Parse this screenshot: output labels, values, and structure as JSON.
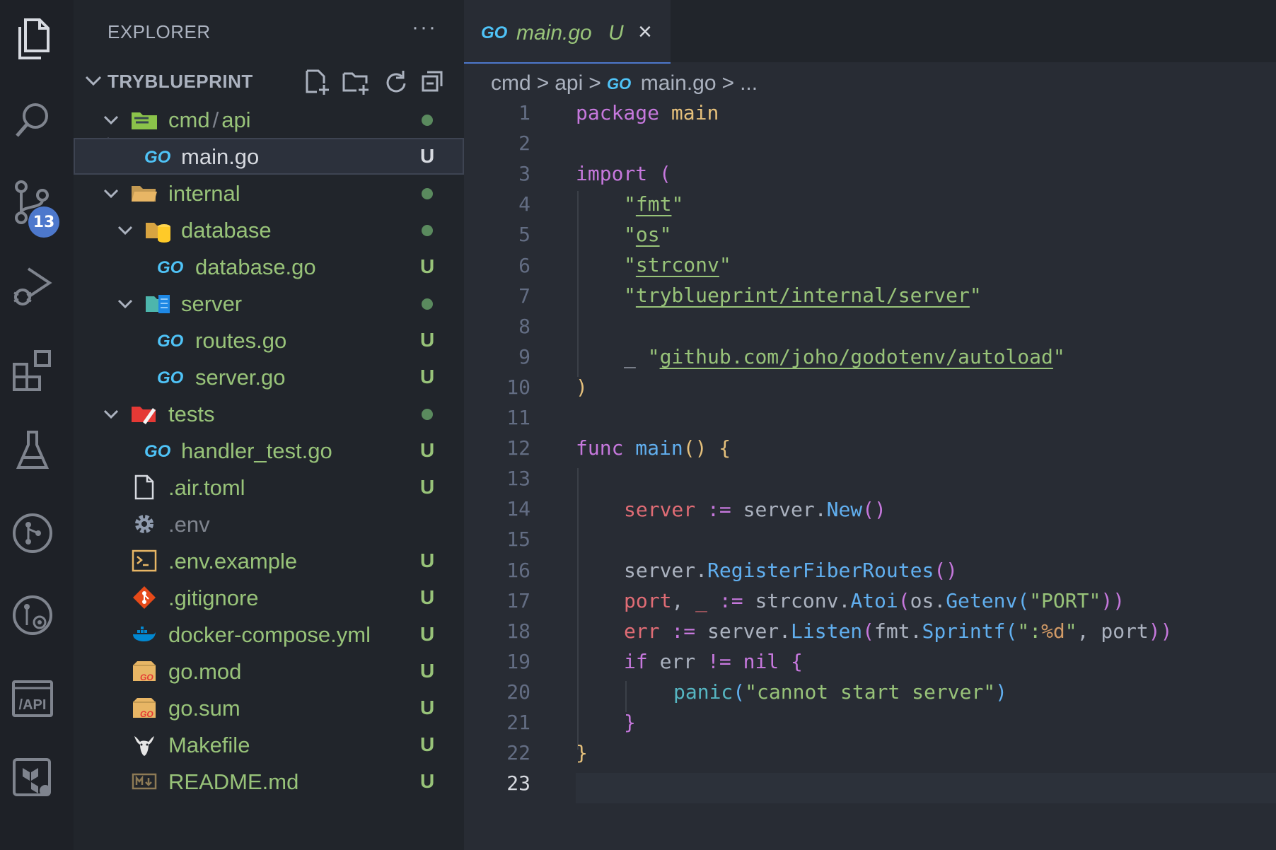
{
  "activity_bar": {
    "items": [
      "explorer-icon",
      "search-icon",
      "source-control-icon",
      "run-debug-icon",
      "extensions-icon",
      "testing-icon",
      "git-graph-icon",
      "github-actions-icon",
      "api-icon",
      "terraform-icon"
    ],
    "source_control_badge": "13"
  },
  "sidebar": {
    "title": "EXPLORER",
    "more": "···",
    "project": "TRYBLUEPRINT",
    "tree": [
      {
        "name": "cmd",
        "name2": "api",
        "sep": "/",
        "status": "dot",
        "icon": "folder-cmd-icon",
        "kind": "folder"
      },
      {
        "name": "main.go",
        "status": "U",
        "icon": "go-file-icon",
        "kind": "file"
      },
      {
        "name": "internal",
        "status": "dot",
        "icon": "folder-open-icon",
        "kind": "folder"
      },
      {
        "name": "database",
        "status": "dot",
        "icon": "folder-database-icon",
        "kind": "folder"
      },
      {
        "name": "database.go",
        "status": "U",
        "icon": "go-file-icon",
        "kind": "file"
      },
      {
        "name": "server",
        "status": "dot",
        "icon": "folder-server-icon",
        "kind": "folder"
      },
      {
        "name": "routes.go",
        "status": "U",
        "icon": "go-file-icon",
        "kind": "file"
      },
      {
        "name": "server.go",
        "status": "U",
        "icon": "go-file-icon",
        "kind": "file"
      },
      {
        "name": "tests",
        "status": "dot",
        "icon": "folder-tests-icon",
        "kind": "folder"
      },
      {
        "name": "handler_test.go",
        "status": "U",
        "icon": "go-file-icon",
        "kind": "file"
      },
      {
        "name": ".air.toml",
        "status": "U",
        "icon": "file-icon",
        "kind": "file"
      },
      {
        "name": ".env",
        "status": "",
        "icon": "gear-icon",
        "kind": "file"
      },
      {
        "name": ".env.example",
        "status": "U",
        "icon": "terminal-file-icon",
        "kind": "file"
      },
      {
        "name": ".gitignore",
        "status": "U",
        "icon": "git-icon",
        "kind": "file"
      },
      {
        "name": "docker-compose.yml",
        "status": "U",
        "icon": "docker-icon",
        "kind": "file"
      },
      {
        "name": "go.mod",
        "status": "U",
        "icon": "go-mod-icon",
        "kind": "file"
      },
      {
        "name": "go.sum",
        "status": "U",
        "icon": "go-mod-icon",
        "kind": "file"
      },
      {
        "name": "Makefile",
        "status": "U",
        "icon": "gnu-icon",
        "kind": "file"
      },
      {
        "name": "README.md",
        "status": "U",
        "icon": "markdown-icon",
        "kind": "file"
      }
    ]
  },
  "editor": {
    "tab": {
      "name": "main.go",
      "status": "U",
      "close": "×"
    },
    "breadcrumb": [
      "cmd",
      "api",
      "main.go",
      "..."
    ],
    "breadcrumb_sep": ">",
    "current_line": "23",
    "line_numbers": [
      "1",
      "2",
      "3",
      "4",
      "5",
      "6",
      "7",
      "8",
      "9",
      "10",
      "11",
      "12",
      "13",
      "14",
      "15",
      "16",
      "17",
      "18",
      "19",
      "20",
      "21",
      "22",
      "23"
    ],
    "code": {
      "l1a": "package",
      "l1b": " main",
      "l3a": "import",
      "l3b": " (",
      "l4q1": "\"",
      "l4": "fmt",
      "l4q2": "\"",
      "l5q1": "\"",
      "l5": "os",
      "l5q2": "\"",
      "l6q1": "\"",
      "l6": "strconv",
      "l6q2": "\"",
      "l7q1": "\"",
      "l7": "tryblueprint/internal/server",
      "l7q2": "\"",
      "l9a": "_ ",
      "l9q1": "\"",
      "l9": "github.com/joho/godotenv/autoload",
      "l9q2": "\"",
      "l10": ")",
      "l12a": "func",
      "l12b": " main",
      "l12c": "()",
      "l12d": " {",
      "l14a": "server",
      "l14b": " :=",
      "l14c": " server.",
      "l14d": "New",
      "l14e": "()",
      "l16a": "server.",
      "l16b": "RegisterFiberRoutes",
      "l16c": "()",
      "l17a": "port",
      "l17b": ", ",
      "l17c": "_",
      "l17d": " :=",
      "l17e": " strconv.",
      "l17f": "Atoi",
      "l17g": "(",
      "l17h": "os.",
      "l17i": "Getenv",
      "l17j": "(",
      "l17k": "\"PORT\"",
      "l17l": "))",
      "l18a": "err",
      "l18b": " :=",
      "l18c": " server.",
      "l18d": "Listen",
      "l18e": "(",
      "l18f": "fmt.",
      "l18g": "Sprintf",
      "l18h": "(",
      "l18i": "\":",
      "l18j": "%d",
      "l18k": "\"",
      "l18l": ", port",
      "l18m": "))",
      "l19a": "if",
      "l19b": " err ",
      "l19c": "!=",
      "l19d": " nil",
      "l19e": " {",
      "l20a": "panic",
      "l20b": "(",
      "l20c": "\"cannot start server\"",
      "l20d": ")",
      "l21": "}",
      "l22": "}"
    }
  }
}
